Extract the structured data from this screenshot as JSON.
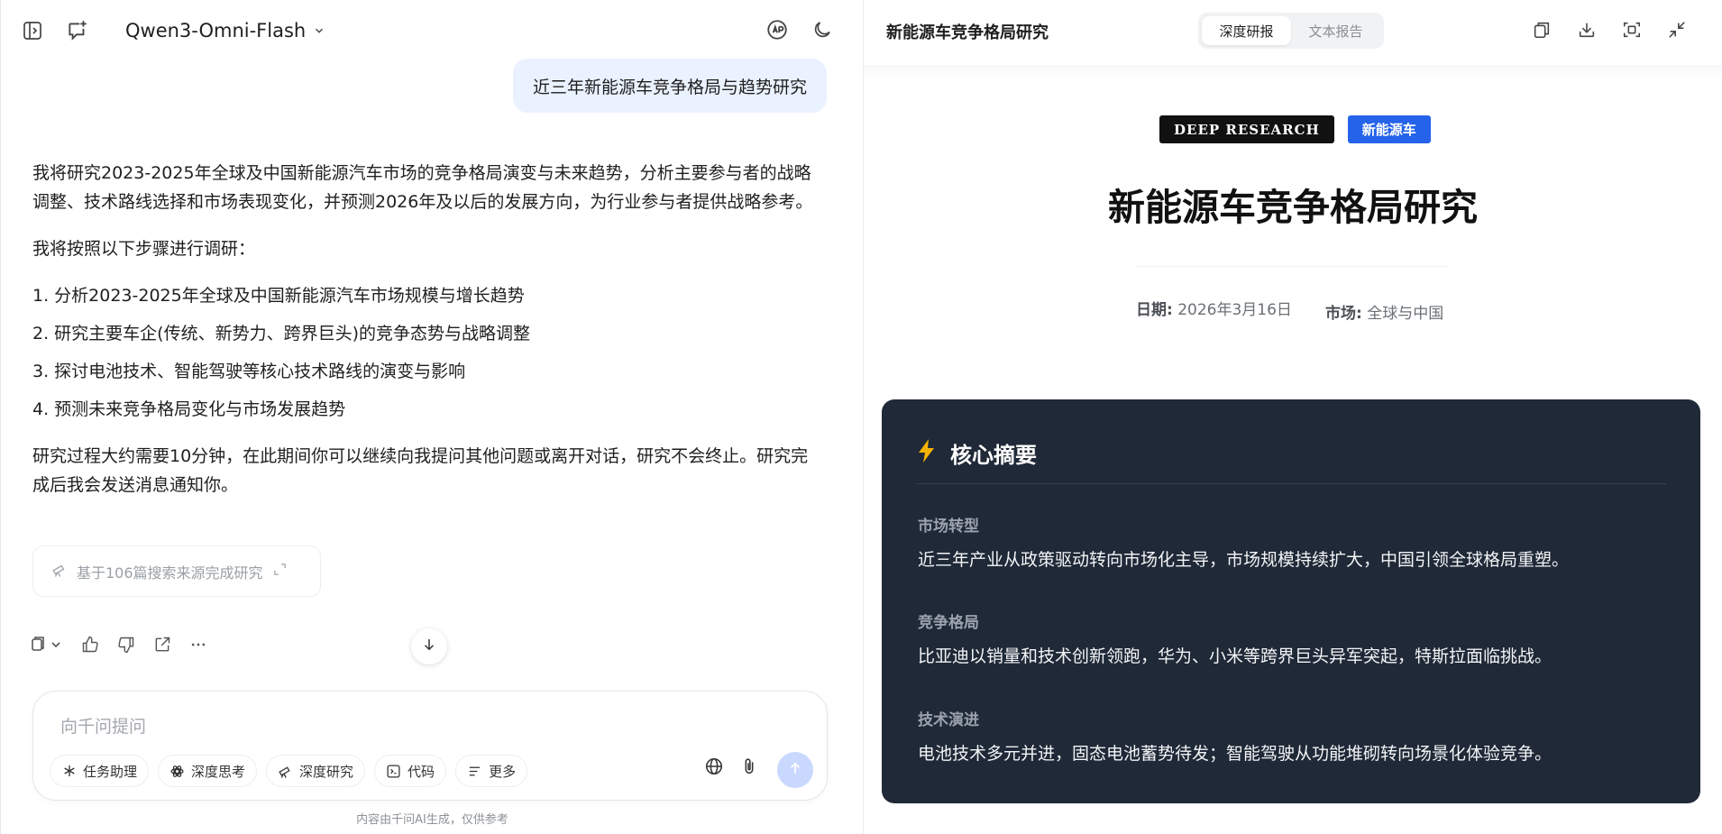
{
  "header": {
    "model_name": "Qwen3-Omni-Flash",
    "icons": [
      "sidebar-toggle-icon",
      "new-chat-icon",
      "chevron-down-icon",
      "translate-icon",
      "moon-icon"
    ]
  },
  "chat": {
    "user_message": "近三年新能源车竞争格局与趋势研究",
    "intro": "我将研究2023-2025年全球及中国新能源汽车市场的竞争格局演变与未来趋势，分析主要参与者的战略调整、技术路线选择和市场表现变化，并预测2026年及以后的发展方向，为行业参与者提供战略参考。",
    "steps_intro": "我将按照以下步骤进行调研：",
    "steps": [
      "1. 分析2023-2025年全球及中国新能源汽车市场规模与增长趋势",
      "2. 研究主要车企(传统、新势力、跨界巨头)的竞争态势与战略调整",
      "3. 探讨电池技术、智能驾驶等核心技术路线的演变与影响",
      "4. 预测未来竞争格局变化与市场发展趋势"
    ],
    "closing": "研究过程大约需要10分钟，在此期间你可以继续向我提问其他问题或离开对话，研究不会终止。研究完成后我会发送消息通知你。",
    "source_card": "基于106篇搜索来源完成研究"
  },
  "composer": {
    "placeholder": "向千问提问",
    "chips": [
      "任务助理",
      "深度思考",
      "深度研究",
      "代码",
      "更多"
    ],
    "disclaimer": "内容由千问AI生成，仅供参考"
  },
  "report": {
    "panel_title": "新能源车竞争格局研究",
    "tabs": [
      "深度研报",
      "文本报告"
    ],
    "active_tab": 0,
    "tag_primary": "DEEP RESEARCH",
    "tag_secondary": "新能源车",
    "title": "新能源车竞争格局研究",
    "date_label": "日期:",
    "date_value": "2026年3月16日",
    "market_label": "市场:",
    "market_value": "全球与中国",
    "summary": {
      "heading": "核心摘要",
      "sections": [
        {
          "label": "市场转型",
          "text": "近三年产业从政策驱动转向市场化主导，市场规模持续扩大，中国引领全球格局重塑。"
        },
        {
          "label": "竞争格局",
          "text": "比亚迪以销量和技术创新领跑，华为、小米等跨界巨头异军突起，特斯拉面临挑战。"
        },
        {
          "label": "技术演进",
          "text": "电池技术多元并进，固态电池蓄势待发；智能驾驶从功能堆砌转向场景化体验竞争。"
        }
      ]
    }
  },
  "colors": {
    "accent_blue": "#2563eb",
    "user_bubble": "#eaf2ff",
    "summary_bg": "#1f2937",
    "bolt": "#f5b301"
  }
}
